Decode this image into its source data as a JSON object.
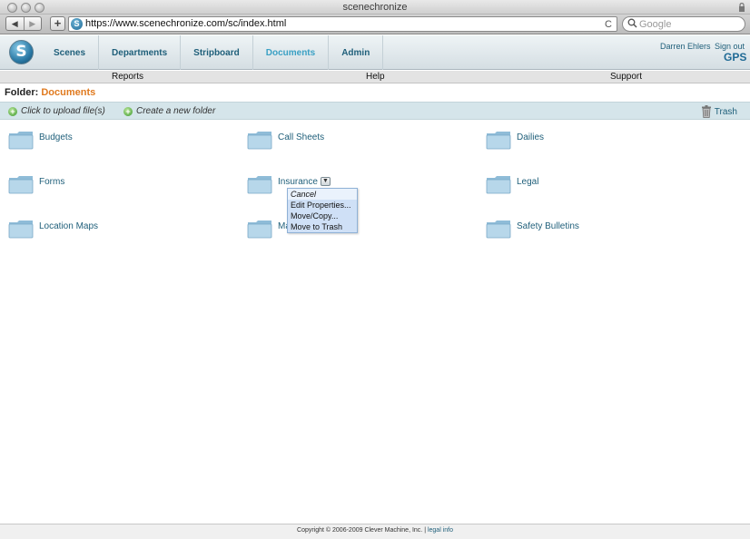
{
  "window": {
    "title": "scenechronize"
  },
  "browser": {
    "url": "https://www.scenechronize.com/sc/index.html",
    "search_placeholder": "Google",
    "back_glyph": "◀",
    "forward_glyph": "▶",
    "add_glyph": "+",
    "reload_glyph": "C",
    "favicon_letter": "S"
  },
  "header": {
    "logo_letter": "S",
    "nav": [
      {
        "label": "Scenes"
      },
      {
        "label": "Departments"
      },
      {
        "label": "Stripboard"
      },
      {
        "label": "Documents",
        "active": true
      },
      {
        "label": "Admin"
      }
    ],
    "user_name": "Darren Ehlers",
    "sign_out": "Sign out",
    "project": "GPS"
  },
  "subnav": {
    "reports": "Reports",
    "help": "Help",
    "support": "Support"
  },
  "folder_path": {
    "label": "Folder:",
    "current": "Documents"
  },
  "actions": {
    "upload": "Click to upload file(s)",
    "new_folder": "Create a new folder",
    "trash": "Trash"
  },
  "folders": [
    {
      "name": "Budgets"
    },
    {
      "name": "Call Sheets"
    },
    {
      "name": "Dailies"
    },
    {
      "name": "Forms"
    },
    {
      "name": "Insurance"
    },
    {
      "name": "Legal"
    },
    {
      "name": "Location Maps"
    },
    {
      "name": "Ma"
    },
    {
      "name": "Safety Bulletins"
    }
  ],
  "context_menu": {
    "items": [
      "Cancel",
      "Edit Properties...",
      "Move/Copy...",
      "Move to Trash"
    ]
  },
  "footer": {
    "copyright": "Copyright © 2006-2009 Clever Machine, Inc. | ",
    "legal": "legal info"
  },
  "colors": {
    "link": "#1f5f7a",
    "active_tab": "#3aa0c4",
    "current_folder": "#e07a1f",
    "action_bar": "#d5e5ea",
    "menu_bg": "#cfe0f6"
  }
}
